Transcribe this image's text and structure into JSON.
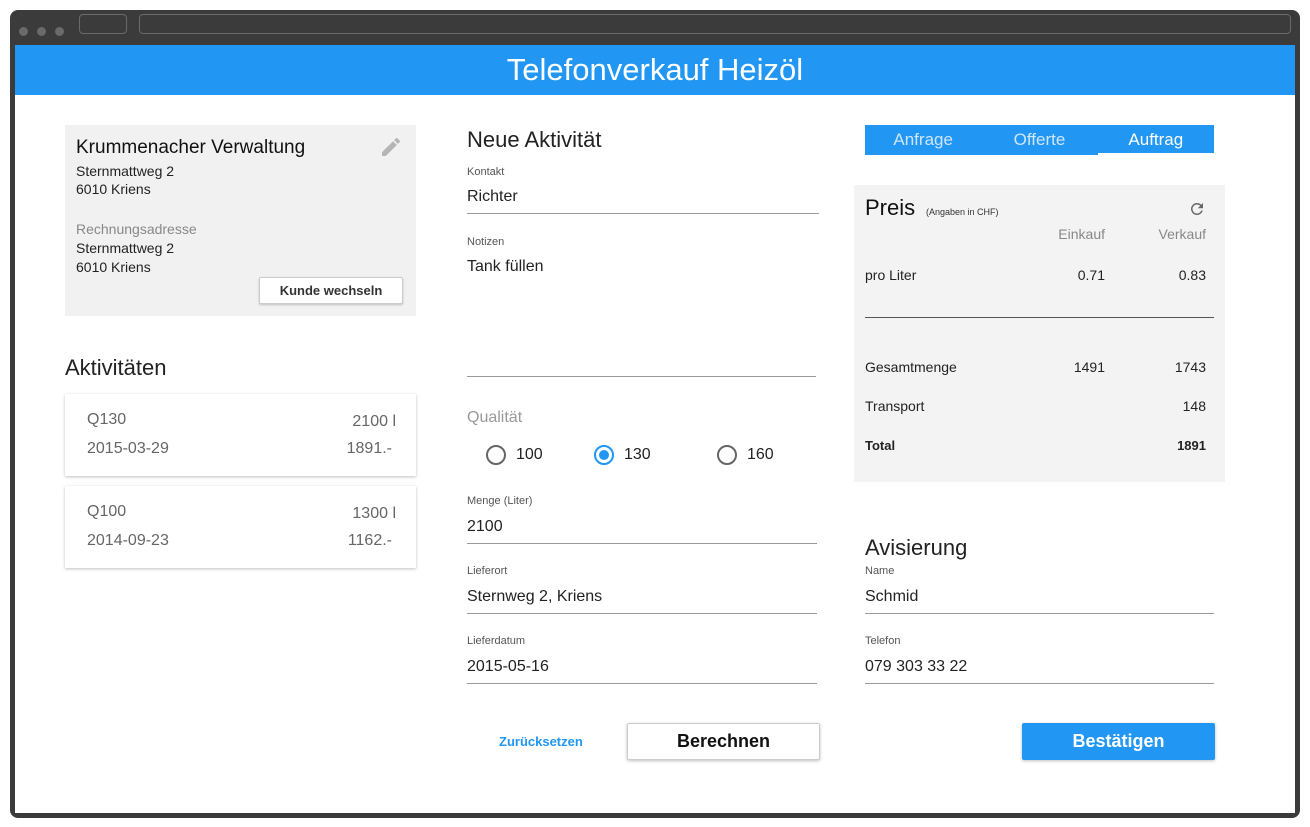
{
  "app": {
    "title": "Telefonverkauf Heizöl"
  },
  "customer": {
    "name": "Krummenacher Verwaltung",
    "street": "Sternmattweg 2",
    "city": "6010 Kriens",
    "billing_label": "Rechnungsadresse",
    "billing_street": "Sternmattweg 2",
    "billing_city": "6010 Kriens",
    "change_button": "Kunde wechseln",
    "edit_icon": "pencil-icon"
  },
  "activities": {
    "heading": "Aktivitäten",
    "items": [
      {
        "quality": "Q130",
        "quantity": "2100  l",
        "date": "2015-03-29",
        "price": "1891.-"
      },
      {
        "quality": "Q100",
        "quantity": "1300  l",
        "date": "2014-09-23",
        "price": "1162.-"
      }
    ]
  },
  "form": {
    "heading": "Neue Aktivität",
    "contact_label": "Kontakt",
    "contact_value": "Richter",
    "notes_label": "Notizen",
    "notes_value": "Tank füllen",
    "quality_label": "Qualität",
    "quality_options": [
      "100",
      "130",
      "160"
    ],
    "quality_selected": "130",
    "amount_label": "Menge (Liter)",
    "amount_value": "2100",
    "location_label": "Lieferort",
    "location_value": "Sternweg 2, Kriens",
    "date_label": "Lieferdatum",
    "date_value": "2015-05-16",
    "reset_button": "Zurücksetzen",
    "calc_button": "Berechnen"
  },
  "tabs": {
    "items": [
      "Anfrage",
      "Offerte",
      "Auftrag"
    ],
    "active": "Auftrag"
  },
  "price": {
    "title": "Preis",
    "subtitle": "(Angaben in CHF)",
    "refresh_icon": "refresh-icon",
    "col_purchase": "Einkauf",
    "col_sale": "Verkauf",
    "rows": [
      {
        "label": "pro Liter",
        "purchase": "0.71",
        "sale": "0.83"
      },
      {
        "label": "Gesamtmenge",
        "purchase": "1491",
        "sale": "1743"
      },
      {
        "label": "Transport",
        "purchase": "",
        "sale": "148"
      },
      {
        "label": "Total",
        "purchase": "",
        "sale": "1891"
      }
    ]
  },
  "notification": {
    "heading": "Avisierung",
    "name_label": "Name",
    "name_value": "Schmid",
    "phone_label": "Telefon",
    "phone_value": "079 303 33 22"
  },
  "confirm_button": "Bestätigen",
  "colors": {
    "accent": "#2196f3",
    "frame": "#3b3b3b",
    "card": "#f1f1f1"
  }
}
